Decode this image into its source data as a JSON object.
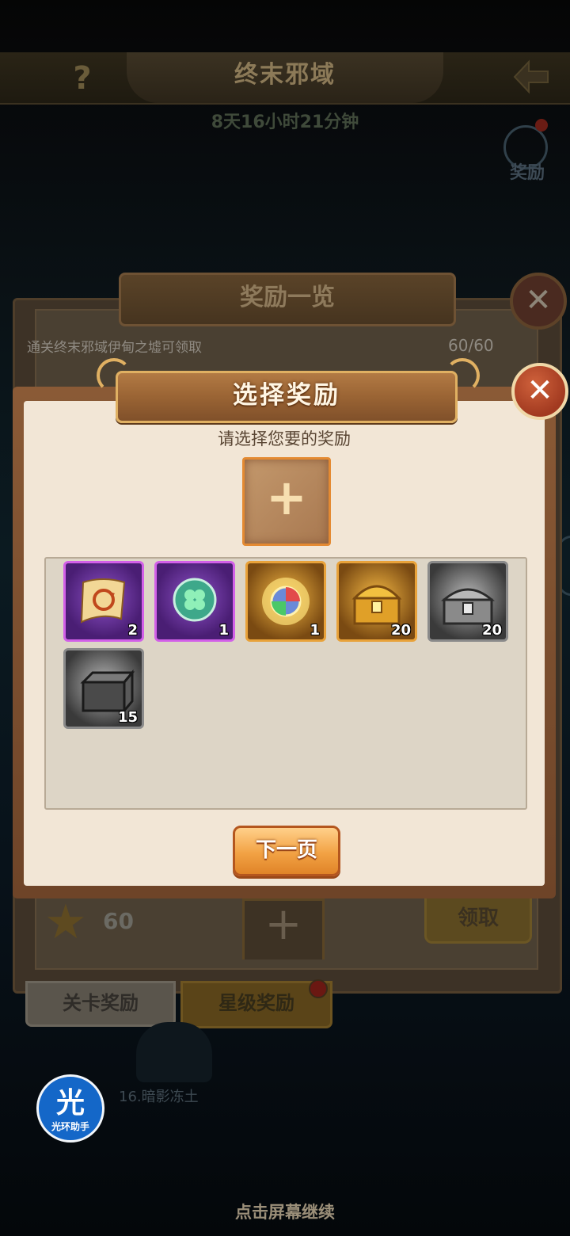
{
  "background": {
    "title": "终末邪域",
    "timer": "8天16小时21分钟",
    "reward_button_label": "奖励",
    "back_panel": {
      "title": "奖励一览",
      "condition": "通关终末邪域伊甸之墟可领取",
      "progress": "60/60",
      "bottom_row_count": "60",
      "claim_label": "领取"
    },
    "tabs": [
      {
        "label": "关卡奖励"
      },
      {
        "label": "星级奖励"
      }
    ],
    "stage_label": "16.暗影冻土",
    "assistant": {
      "big": "光",
      "small": "光环助手"
    },
    "continue_hint": "点击屏幕继续"
  },
  "dialog": {
    "title": "选择奖励",
    "prompt": "请选择您要的奖励",
    "slot_symbol": "+",
    "next_label": "下一页",
    "items": [
      {
        "icon": "scroll-icon",
        "rarity": "purple",
        "count": "2"
      },
      {
        "icon": "clover-orb-icon",
        "rarity": "purple",
        "count": "1"
      },
      {
        "icon": "rainbow-orb-icon",
        "rarity": "orange",
        "count": "1"
      },
      {
        "icon": "gold-chest-icon",
        "rarity": "orange",
        "count": "20"
      },
      {
        "icon": "silver-chest-icon",
        "rarity": "grey",
        "count": "20"
      },
      {
        "icon": "iron-box-icon",
        "rarity": "grey",
        "count": "15"
      }
    ]
  },
  "colors": {
    "dialog_bg": "#f2e6d6",
    "banner": "#9a6434",
    "next_button": "#f2a244",
    "close_button": "#a23a20"
  }
}
